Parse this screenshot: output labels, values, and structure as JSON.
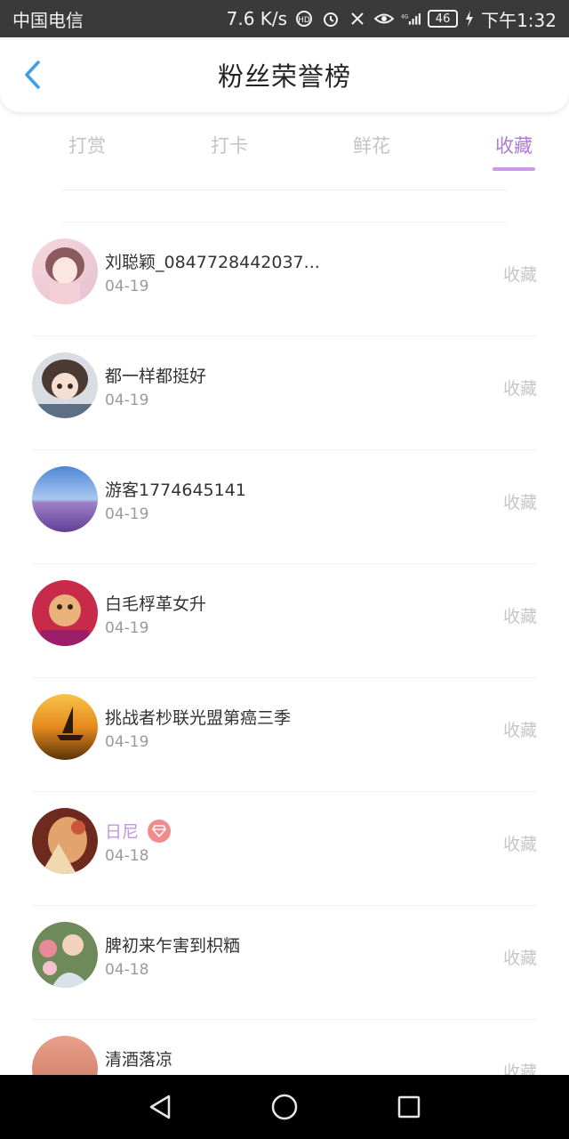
{
  "status_bar": {
    "carrier": "中国电信",
    "speed": "7.6 K/s",
    "network": "4G",
    "battery": "46",
    "time": "下午1:32"
  },
  "header": {
    "title": "粉丝荣誉榜"
  },
  "tabs": [
    {
      "label": "打赏",
      "active": false
    },
    {
      "label": "打卡",
      "active": false
    },
    {
      "label": "鲜花",
      "active": false
    },
    {
      "label": "收藏",
      "active": true
    }
  ],
  "colors": {
    "accent": "#b07ad6",
    "vip_name": "#c894e0",
    "gem_badge": "#f28b8b"
  },
  "list": [
    {
      "name": "刘聪颖_0847728442037...",
      "date": "04-19",
      "action": "收藏",
      "vip": false
    },
    {
      "name": "都一样都挺好",
      "date": "04-19",
      "action": "收藏",
      "vip": false
    },
    {
      "name": "游客1774645141",
      "date": "04-19",
      "action": "收藏",
      "vip": false
    },
    {
      "name": "白毛桴革女升",
      "date": "04-19",
      "action": "收藏",
      "vip": false
    },
    {
      "name": "挑战者杪联光盟第癌三季",
      "date": "04-19",
      "action": "收藏",
      "vip": false
    },
    {
      "name": "日尼",
      "date": "04-18",
      "action": "收藏",
      "vip": true
    },
    {
      "name": "脾初来乍害到枳粞",
      "date": "04-18",
      "action": "收藏",
      "vip": false
    },
    {
      "name": "清酒落凉",
      "date": "",
      "action": "收藏",
      "vip": false
    }
  ]
}
